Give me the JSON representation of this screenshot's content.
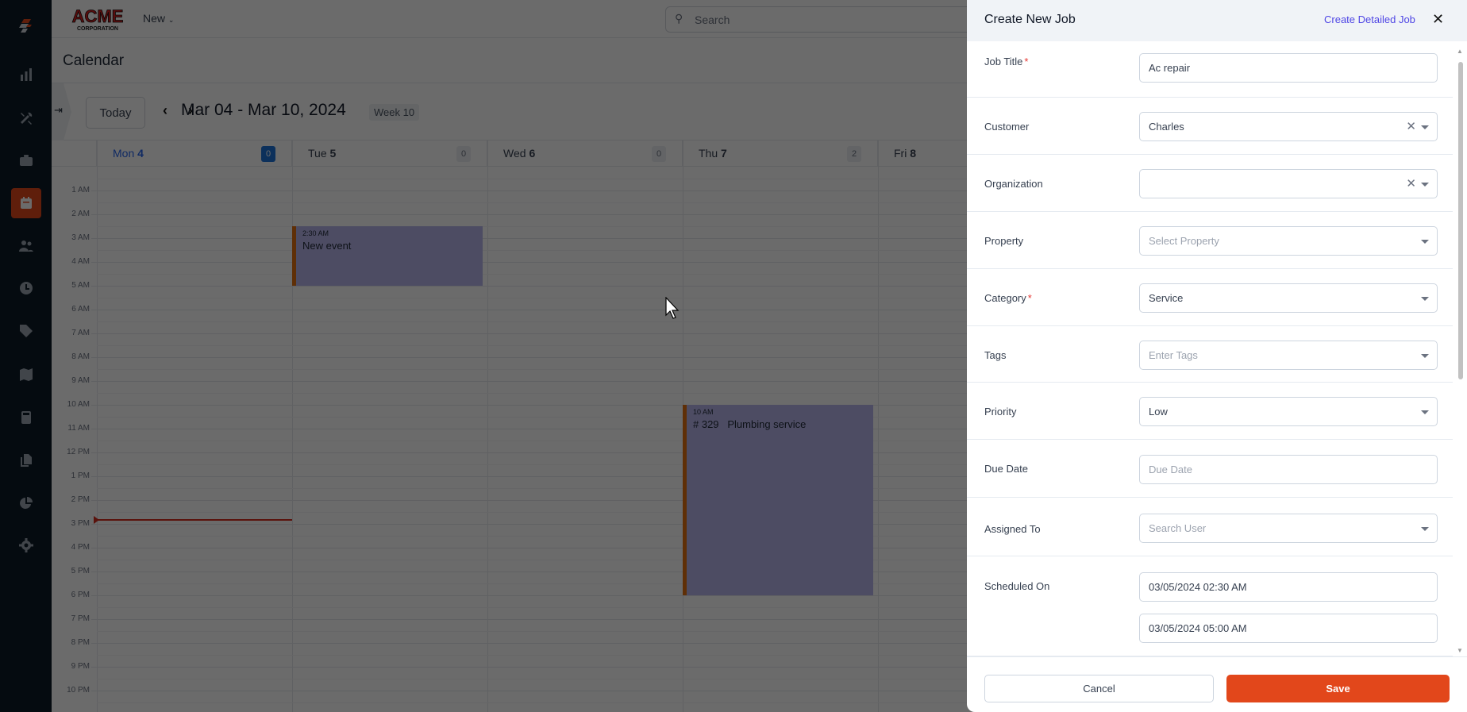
{
  "app": {
    "logo_text": "ACME CORPORATION",
    "new_label": "New",
    "search_placeholder": "Search"
  },
  "sidebar": {
    "items": [
      "logo",
      "reports",
      "tools",
      "jobs",
      "calendar",
      "customers",
      "timesheets",
      "pricebook",
      "map",
      "estimates",
      "documents",
      "analytics",
      "settings"
    ],
    "active": "calendar"
  },
  "calendar": {
    "title": "Calendar",
    "today_label": "Today",
    "range": "Mar 04 - Mar 10, 2024",
    "week": "Week 10",
    "days": [
      {
        "name": "Mon",
        "num": "4",
        "count": "0",
        "today": true
      },
      {
        "name": "Tue",
        "num": "5",
        "count": "0"
      },
      {
        "name": "Wed",
        "num": "6",
        "count": "0"
      },
      {
        "name": "Thu",
        "num": "7",
        "count": "2"
      },
      {
        "name": "Fri",
        "num": "8"
      }
    ],
    "hours": [
      "1 AM",
      "2 AM",
      "3 AM",
      "4 AM",
      "5 AM",
      "6 AM",
      "7 AM",
      "8 AM",
      "9 AM",
      "10 AM",
      "11 AM",
      "12 PM",
      "1 PM",
      "2 PM",
      "3 PM",
      "4 PM",
      "5 PM",
      "6 PM",
      "7 PM",
      "8 PM",
      "9 PM",
      "10 PM"
    ],
    "events": [
      {
        "day": 1,
        "start": 2.5,
        "end": 5,
        "time": "2:30 AM",
        "title": "New event"
      },
      {
        "day": 3,
        "start": 10,
        "end": 18,
        "time": "10 AM",
        "title": "# 329   Plumbing service"
      }
    ],
    "event_color": "#b7b5ec",
    "event_accent": "#e26f10"
  },
  "panel": {
    "title": "Create New Job",
    "detailed_link": "Create Detailed Job",
    "fields": {
      "job_title": {
        "label": "Job Title",
        "value": "Ac repair"
      },
      "customer": {
        "label": "Customer",
        "value": "Charles"
      },
      "organization": {
        "label": "Organization",
        "value": ""
      },
      "property": {
        "label": "Property",
        "placeholder": "Select Property"
      },
      "category": {
        "label": "Category",
        "value": "Service"
      },
      "tags": {
        "label": "Tags",
        "placeholder": "Enter Tags"
      },
      "priority": {
        "label": "Priority",
        "value": "Low"
      },
      "due_date": {
        "label": "Due Date",
        "placeholder": "Due Date"
      },
      "assigned_to": {
        "label": "Assigned To",
        "placeholder": "Search User"
      },
      "scheduled_on": {
        "label": "Scheduled On",
        "start": "03/05/2024 02:30 AM",
        "end": "03/05/2024 05:00 AM"
      }
    },
    "required_mark": "*",
    "cancel": "Cancel",
    "save": "Save",
    "save_color": "#e2471b"
  }
}
